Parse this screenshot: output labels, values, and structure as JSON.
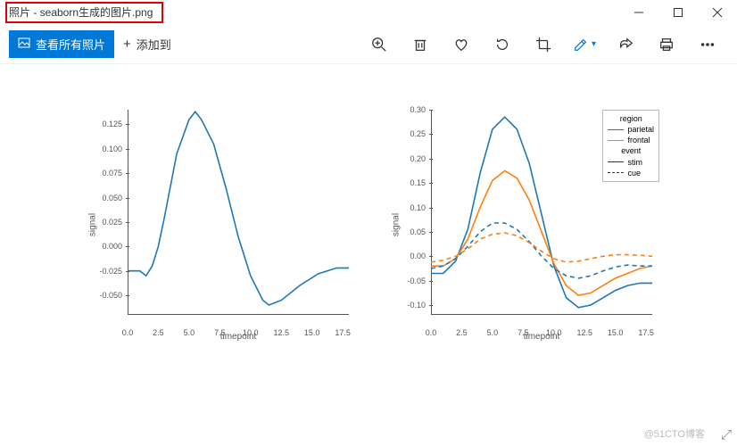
{
  "window": {
    "title": "照片 - seaborn生成的图片.png"
  },
  "toolbar": {
    "view_all_label": "查看所有照片",
    "add_to_label": "添加到"
  },
  "watermark": "@51CTO博客",
  "chart_data": [
    {
      "type": "line",
      "xlabel": "timepoint",
      "ylabel": "signal",
      "xlim": [
        0,
        18
      ],
      "ylim": [
        -0.07,
        0.14
      ],
      "xticks": [
        0.0,
        2.5,
        5.0,
        7.5,
        10.0,
        12.5,
        15.0,
        17.5
      ],
      "yticks": [
        -0.05,
        -0.025,
        0.0,
        0.025,
        0.05,
        0.075,
        0.1,
        0.125
      ],
      "series": [
        {
          "name": "signal",
          "color": "#1f77b4",
          "style": "solid",
          "x": [
            0.0,
            1.0,
            1.5,
            2.0,
            2.5,
            3.0,
            4.0,
            5.0,
            5.5,
            6.0,
            7.0,
            8.0,
            9.0,
            10.0,
            11.0,
            11.5,
            12.5,
            14.0,
            15.5,
            17.0,
            18.0
          ],
          "y": [
            -0.025,
            -0.025,
            -0.03,
            -0.02,
            0.0,
            0.03,
            0.095,
            0.13,
            0.138,
            0.13,
            0.105,
            0.06,
            0.01,
            -0.03,
            -0.055,
            -0.06,
            -0.055,
            -0.04,
            -0.028,
            -0.022,
            -0.022
          ]
        }
      ]
    },
    {
      "type": "line",
      "xlabel": "timepoint",
      "ylabel": "signal",
      "xlim": [
        0,
        18
      ],
      "ylim": [
        -0.12,
        0.3
      ],
      "xticks": [
        0.0,
        2.5,
        5.0,
        7.5,
        10.0,
        12.5,
        15.0,
        17.5
      ],
      "yticks": [
        -0.1,
        -0.05,
        0.0,
        0.05,
        0.1,
        0.15,
        0.2,
        0.25,
        0.3
      ],
      "legend": {
        "title1": "region",
        "items_region": [
          {
            "label": "parietal",
            "color": "#1f77b4"
          },
          {
            "label": "frontal",
            "color": "#ff7f0e"
          }
        ],
        "title2": "event",
        "items_event": [
          {
            "label": "stim",
            "style": "solid"
          },
          {
            "label": "cue",
            "style": "dashed"
          }
        ]
      },
      "series": [
        {
          "name": "parietal_stim",
          "color": "#1f77b4",
          "style": "solid",
          "x": [
            0,
            1,
            2,
            3,
            4,
            5,
            6,
            7,
            8,
            9,
            10,
            11,
            12,
            13,
            14,
            15,
            16,
            17,
            18
          ],
          "y": [
            -0.035,
            -0.035,
            -0.01,
            0.055,
            0.17,
            0.26,
            0.285,
            0.26,
            0.19,
            0.085,
            -0.02,
            -0.085,
            -0.105,
            -0.1,
            -0.085,
            -0.07,
            -0.06,
            -0.055,
            -0.055
          ]
        },
        {
          "name": "frontal_stim",
          "color": "#ff7f0e",
          "style": "solid",
          "x": [
            0,
            1,
            2,
            3,
            4,
            5,
            6,
            7,
            8,
            9,
            10,
            11,
            12,
            13,
            14,
            15,
            16,
            17,
            18
          ],
          "y": [
            -0.02,
            -0.02,
            -0.005,
            0.035,
            0.1,
            0.155,
            0.175,
            0.16,
            0.115,
            0.05,
            -0.015,
            -0.06,
            -0.08,
            -0.075,
            -0.06,
            -0.045,
            -0.035,
            -0.025,
            -0.02
          ]
        },
        {
          "name": "parietal_cue",
          "color": "#1f77b4",
          "style": "dashed",
          "x": [
            0,
            1,
            2,
            3,
            4,
            5,
            6,
            7,
            8,
            9,
            10,
            11,
            12,
            13,
            14,
            15,
            16,
            17,
            18
          ],
          "y": [
            -0.025,
            -0.02,
            -0.005,
            0.02,
            0.05,
            0.068,
            0.068,
            0.055,
            0.03,
            0.0,
            -0.025,
            -0.04,
            -0.045,
            -0.04,
            -0.03,
            -0.022,
            -0.018,
            -0.02,
            -0.02
          ]
        },
        {
          "name": "frontal_cue",
          "color": "#ff7f0e",
          "style": "dashed",
          "x": [
            0,
            1,
            2,
            3,
            4,
            5,
            6,
            7,
            8,
            9,
            10,
            11,
            12,
            13,
            14,
            15,
            16,
            17,
            18
          ],
          "y": [
            -0.012,
            -0.008,
            0.0,
            0.015,
            0.035,
            0.045,
            0.048,
            0.042,
            0.028,
            0.01,
            -0.005,
            -0.012,
            -0.01,
            -0.005,
            0.0,
            0.003,
            0.003,
            0.002,
            0.0
          ]
        }
      ]
    }
  ]
}
